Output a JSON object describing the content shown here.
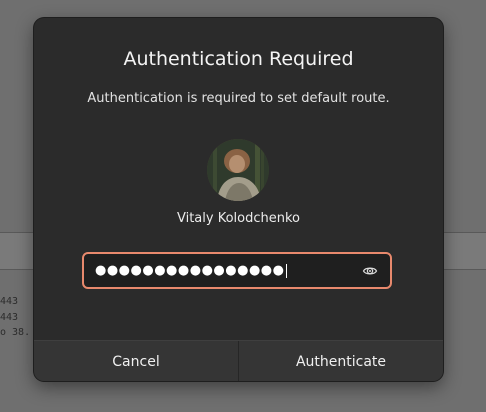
{
  "background": {
    "terminal_lines": [
      "443",
      "443",
      "o 38."
    ]
  },
  "dialog": {
    "title": "Authentication Required",
    "message": "Authentication is required to set default route.",
    "user": {
      "name": "Vitaly Kolodchenko"
    },
    "password": {
      "masked_value": "●●●●●●●●●●●●●●●●",
      "reveal_icon": "eye-icon"
    },
    "buttons": {
      "cancel_label": "Cancel",
      "authenticate_label": "Authenticate"
    }
  },
  "colors": {
    "focus_ring": "#e8896d",
    "dialog_bg": "#2b2b2b"
  }
}
